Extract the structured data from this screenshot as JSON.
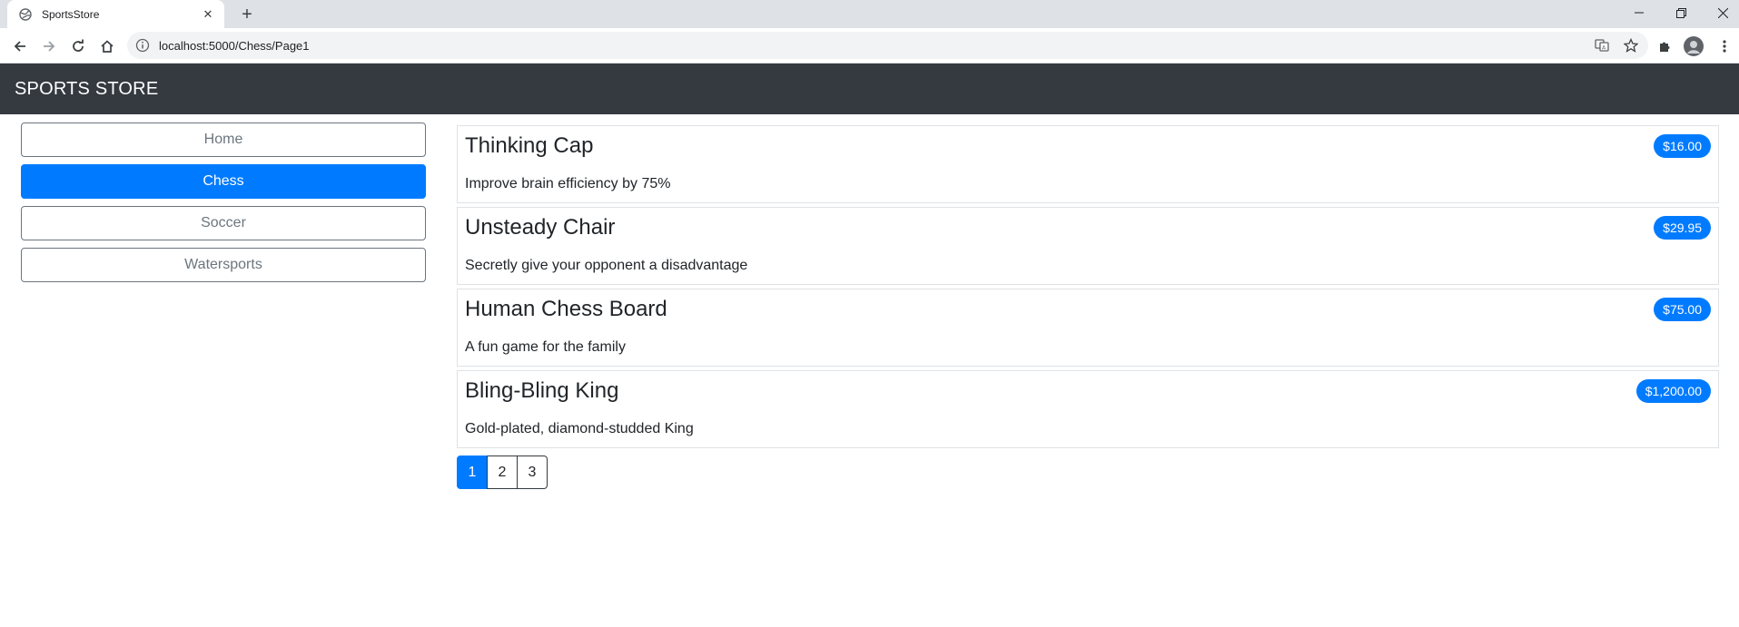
{
  "browser": {
    "tab_title": "SportsStore",
    "url": "localhost:5000/Chess/Page1"
  },
  "navbar": {
    "brand": "SPORTS STORE"
  },
  "sidebar": {
    "items": [
      {
        "label": "Home",
        "active": false
      },
      {
        "label": "Chess",
        "active": true
      },
      {
        "label": "Soccer",
        "active": false
      },
      {
        "label": "Watersports",
        "active": false
      }
    ]
  },
  "products": [
    {
      "name": "Thinking Cap",
      "description": "Improve brain efficiency by 75%",
      "price": "$16.00"
    },
    {
      "name": "Unsteady Chair",
      "description": "Secretly give your opponent a disadvantage",
      "price": "$29.95"
    },
    {
      "name": "Human Chess Board",
      "description": "A fun game for the family",
      "price": "$75.00"
    },
    {
      "name": "Bling-Bling King",
      "description": "Gold-plated, diamond-studded King",
      "price": "$1,200.00"
    }
  ],
  "pagination": {
    "pages": [
      "1",
      "2",
      "3"
    ],
    "current": "1"
  },
  "colors": {
    "navbar_bg": "#343a40",
    "primary": "#007bff",
    "secondary": "#6c757d"
  }
}
